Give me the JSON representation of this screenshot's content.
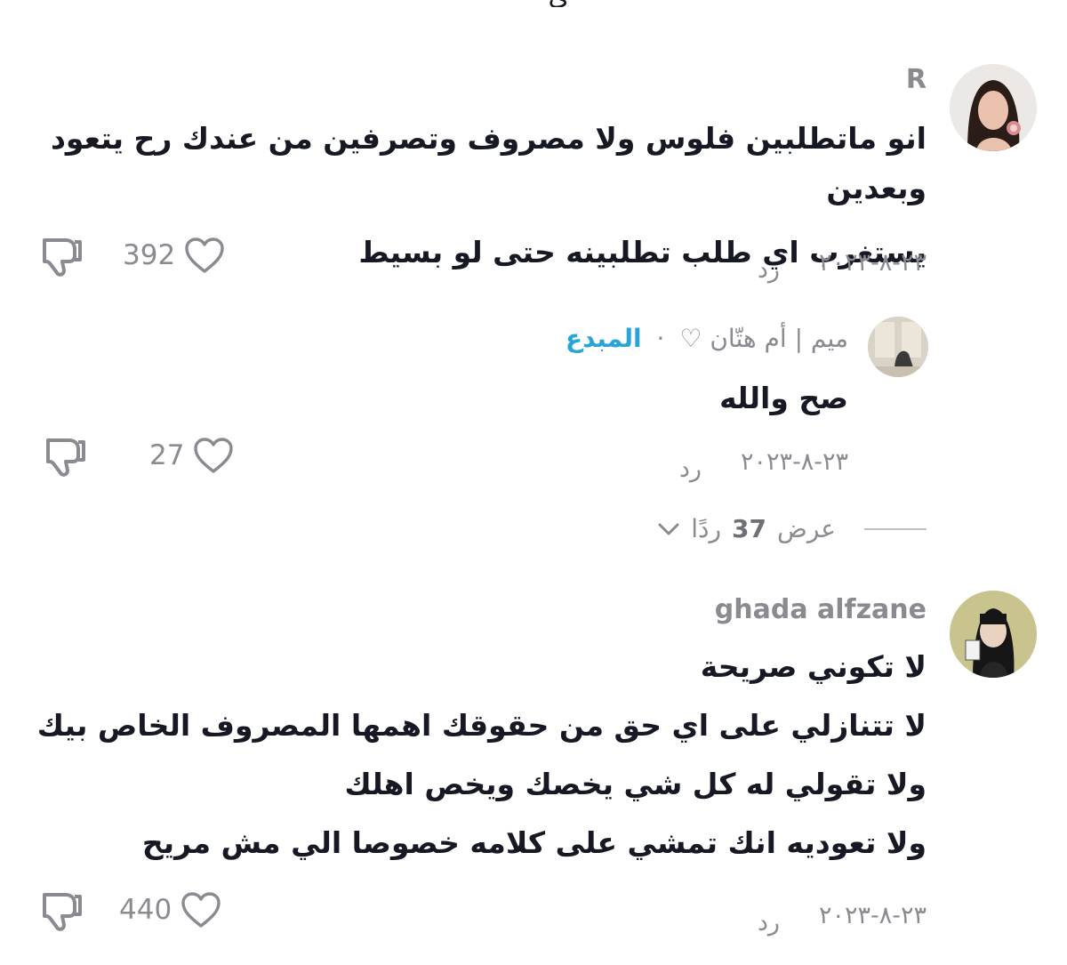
{
  "top_partial_text": "ي",
  "comments": [
    {
      "username": "R",
      "lines": [
        "انو ماتطلبين فلوس ولا مصروف وتصرفين من عندك رح يتعود وبعدين",
        "يستغرب اي طلب تطلبينه حتى لو بسيط"
      ],
      "date": "٢٣-٨-٢٠٢٣",
      "reply_label": "رد",
      "likes": "392",
      "avatar_icon": "profile-photo"
    },
    {
      "username": "ميم | أم هتّان ♡",
      "separator": "·",
      "creator_badge": "المبدع",
      "lines": [
        "صح والله"
      ],
      "date": "٢٣-٨-٢٠٢٣",
      "reply_label": "رد",
      "likes": "27",
      "avatar_icon": "profile-photo"
    },
    {
      "username": "ghada alfzane",
      "lines": [
        "لا تكوني صريحة",
        "لا تتنازلي على اي حق من حقوقك اهمها المصروف الخاص بيك",
        "ولا تقولي له كل شي يخصك ويخص اهلك",
        "ولا تعوديه انك تمشي على كلامه خصوصا الي مش مريح"
      ],
      "date": "٢٣-٨-٢٠٢٣",
      "reply_label": "رد",
      "likes": "440",
      "avatar_icon": "cartoon-avatar"
    }
  ],
  "view_replies": {
    "prefix": "عرض",
    "count": "37",
    "suffix": "ردًا",
    "icon": "chevron-down-icon"
  },
  "colors": {
    "text": "#161823",
    "muted": "#8a8b91",
    "creator": "#27a5d4"
  }
}
